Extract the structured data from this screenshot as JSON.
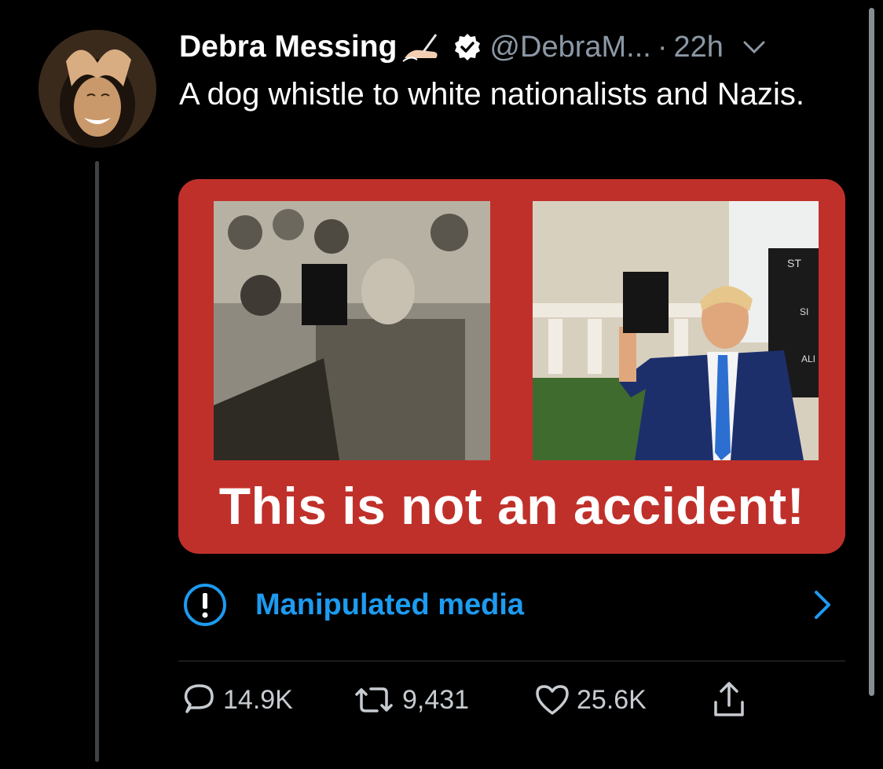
{
  "tweet": {
    "author_name": "Debra Messing",
    "handle": "@DebraM...",
    "separator": "·",
    "time": "22h",
    "text": "A dog whistle to white nationalists and Nazis.",
    "media": {
      "caption": "This is not an accident!",
      "sign_labels": [
        "ST",
        "SI",
        "ALI"
      ]
    },
    "warning": {
      "label": "Manipulated media"
    },
    "stats": {
      "replies": "14.9K",
      "retweets": "9,431",
      "likes": "25.6K"
    }
  },
  "colors": {
    "background": "#000000",
    "accent": "#1d9bf0",
    "muted": "#8b98a5",
    "media_red": "#c0302a"
  },
  "icons": [
    "signature-emoji-icon",
    "verified-badge-icon",
    "chevron-down-icon",
    "info-circle-icon",
    "chevron-right-icon",
    "reply-icon",
    "retweet-icon",
    "heart-icon",
    "share-icon"
  ]
}
